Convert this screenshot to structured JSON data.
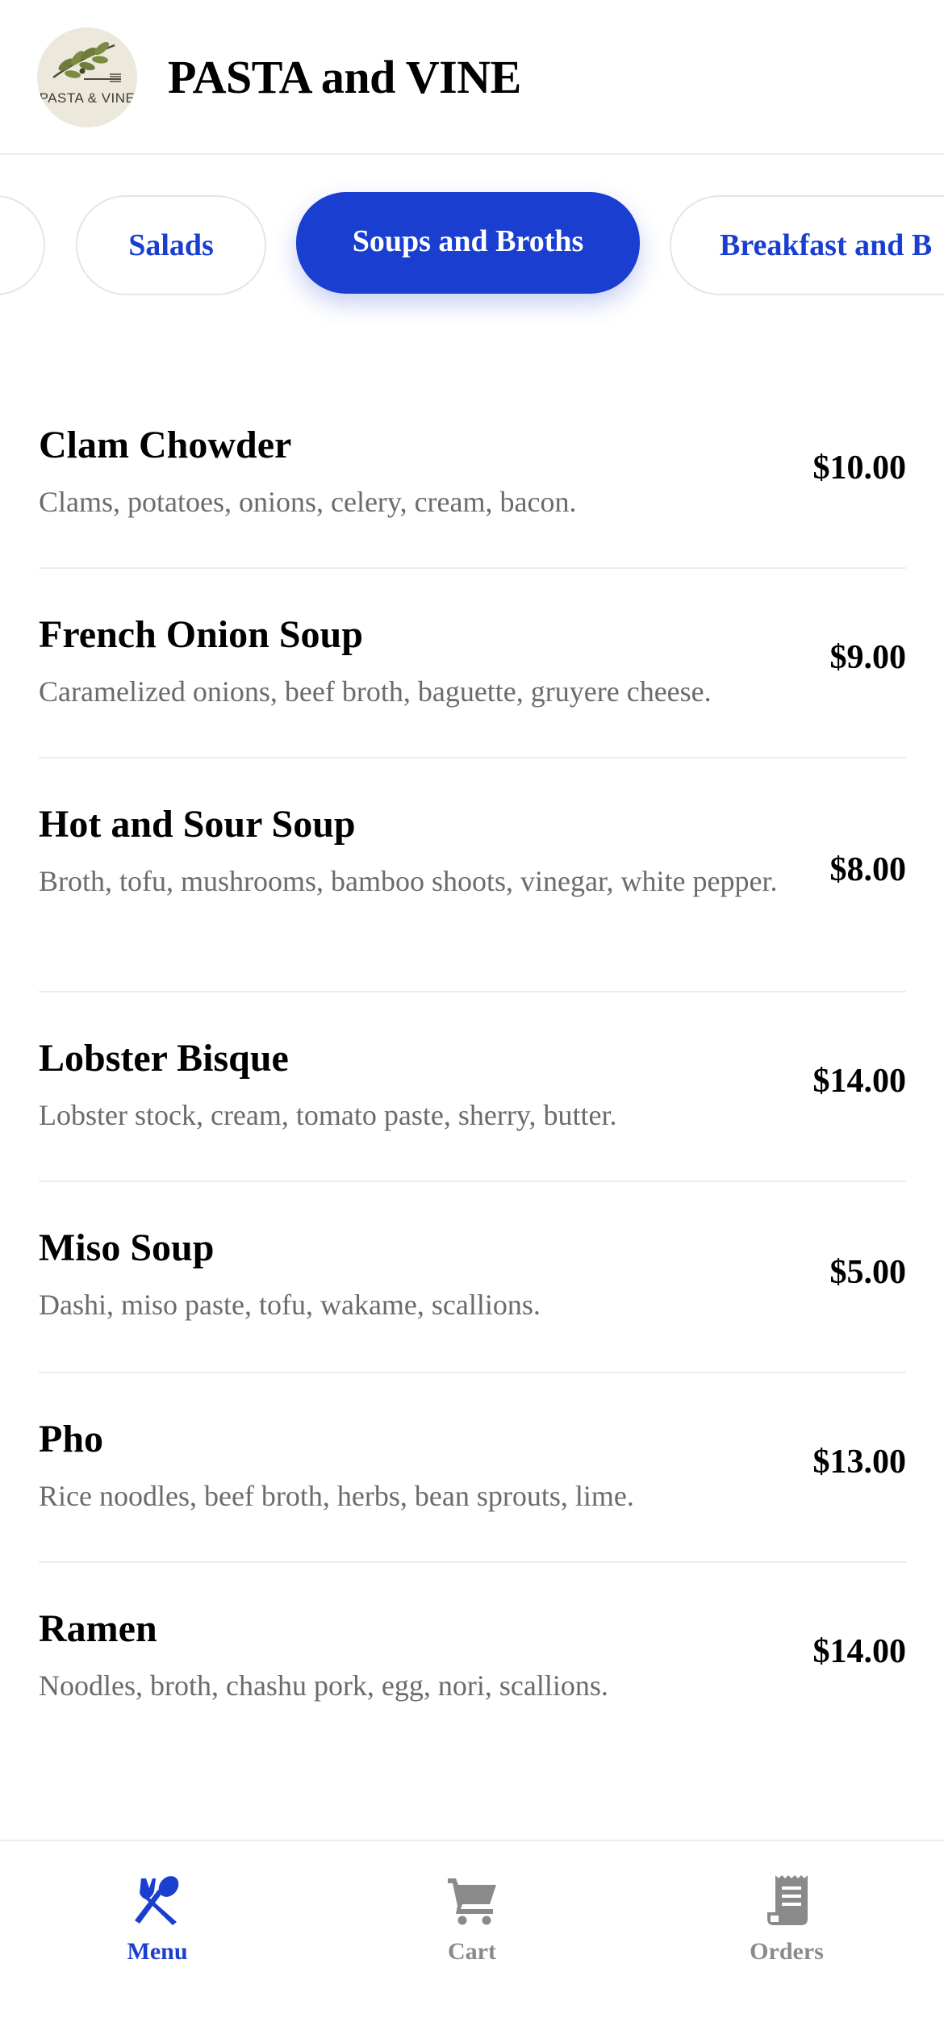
{
  "header": {
    "brand": "PASTA and VINE",
    "logo_text": "PASTA & VINE"
  },
  "categories": [
    {
      "label": ""
    },
    {
      "label": "Salads"
    },
    {
      "label": "Soups and Broths",
      "active": true
    },
    {
      "label": "Breakfast and B"
    }
  ],
  "menu_items": [
    {
      "name": "Clam Chowder",
      "description": "Clams, potatoes, onions, celery, cream, bacon.",
      "price": "$10.00"
    },
    {
      "name": "French Onion Soup",
      "description": "Caramelized onions, beef broth, baguette, gruyere cheese.",
      "price": "$9.00"
    },
    {
      "name": "Hot and Sour Soup",
      "description": "Broth, tofu, mushrooms, bamboo shoots, vinegar, white pepper.",
      "price": "$8.00"
    },
    {
      "name": "Lobster Bisque",
      "description": "Lobster stock, cream, tomato paste, sherry, butter.",
      "price": "$14.00"
    },
    {
      "name": "Miso Soup",
      "description": "Dashi, miso paste, tofu, wakame, scallions.",
      "price": "$5.00"
    },
    {
      "name": "Pho",
      "description": "Rice noodles, beef broth, herbs, bean sprouts, lime.",
      "price": "$13.00"
    },
    {
      "name": "Ramen",
      "description": "Noodles, broth, chashu pork, egg, nori, scallions.",
      "price": "$14.00"
    }
  ],
  "bottom_nav": [
    {
      "label": "Menu",
      "icon": "utensils-icon",
      "active": true
    },
    {
      "label": "Cart",
      "icon": "cart-icon"
    },
    {
      "label": "Orders",
      "icon": "receipt-icon"
    }
  ],
  "colors": {
    "accent": "#1a3fd0",
    "muted_text": "#6b6b6b",
    "inactive_nav": "#8a8a8a",
    "logo_bg": "#ece8dc"
  }
}
